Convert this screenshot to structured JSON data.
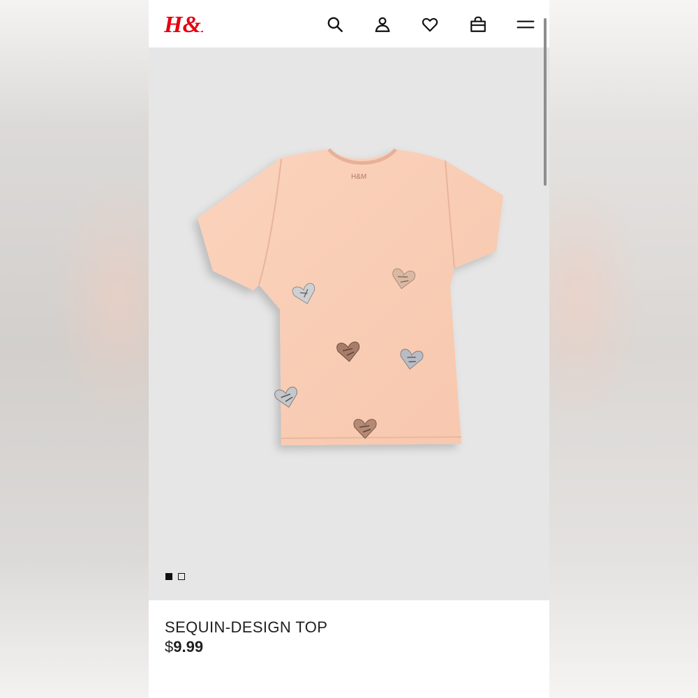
{
  "brand": {
    "logo_text": "H&M",
    "color": "#e50010"
  },
  "header": {
    "icons": [
      "search-icon",
      "account-icon",
      "favorites-icon",
      "shopping-bag-icon",
      "menu-icon"
    ]
  },
  "gallery": {
    "image_count": 2,
    "active_index": 0
  },
  "product": {
    "name": "SEQUIN-DESIGN TOP",
    "price_currency": "$",
    "price_value": "9.99",
    "tag_text": "H&M"
  }
}
